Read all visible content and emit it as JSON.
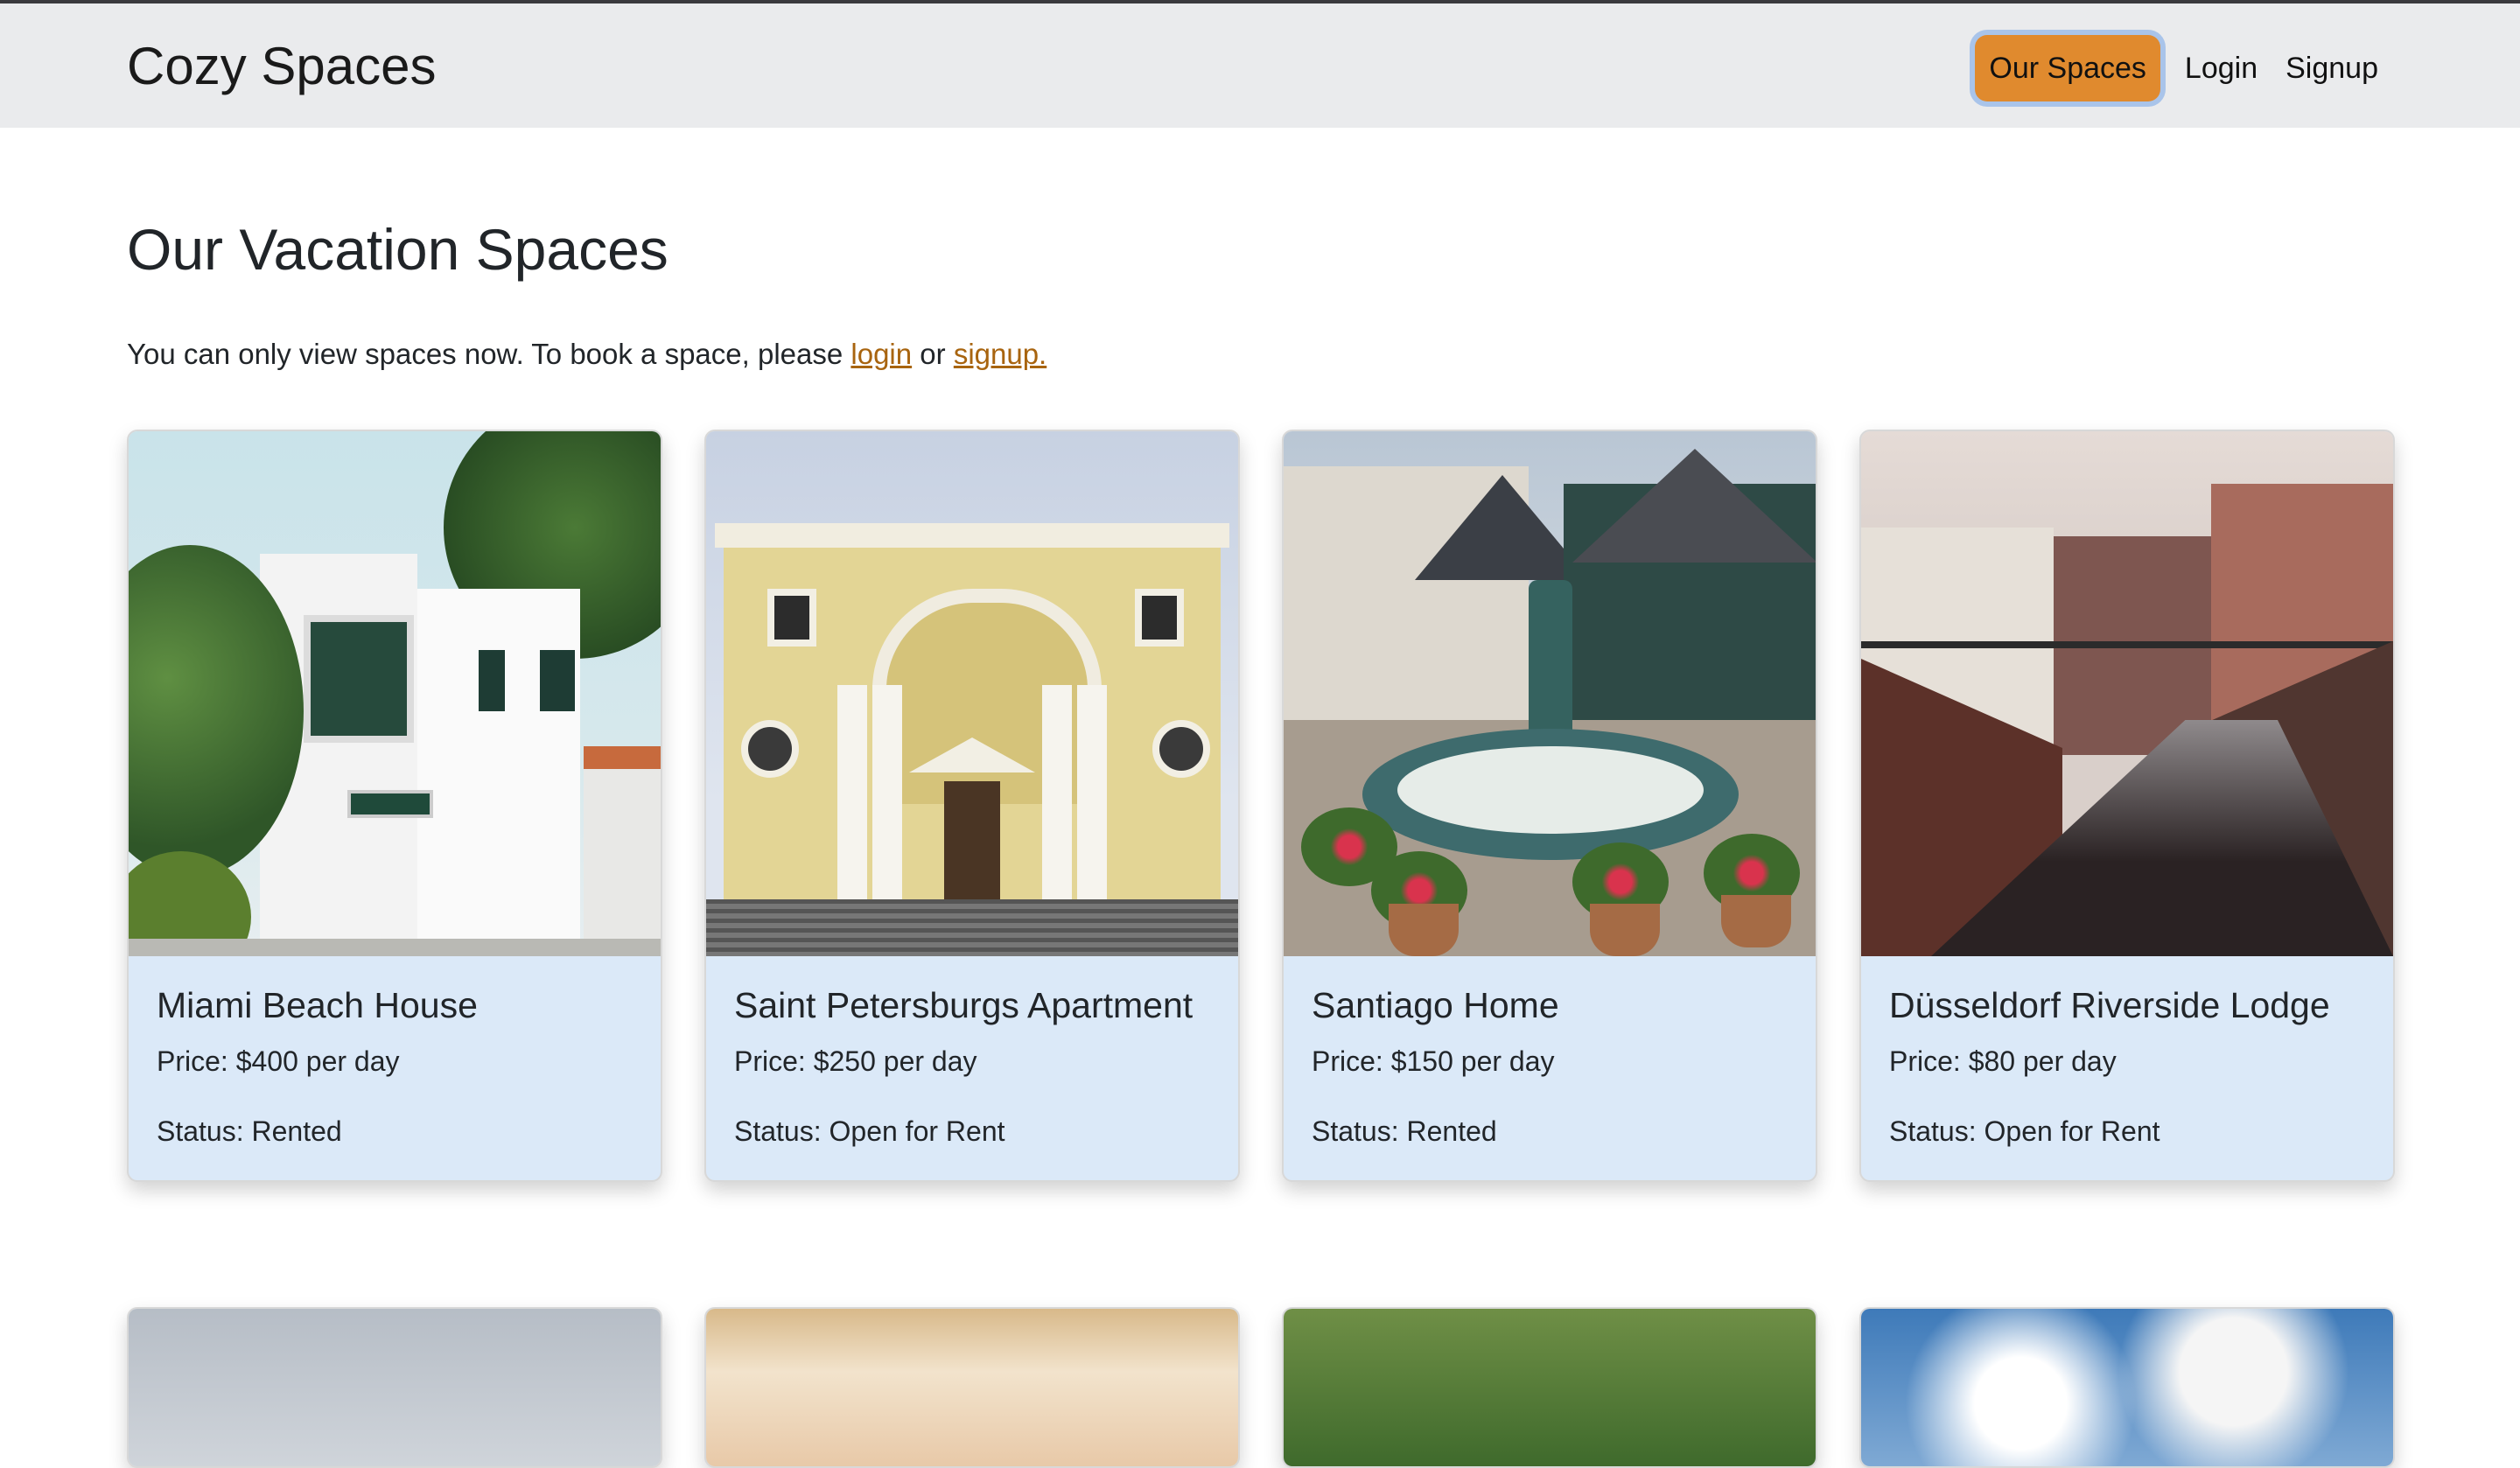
{
  "navbar": {
    "brand": "Cozy Spaces",
    "links": [
      {
        "label": "Our Spaces",
        "active": true
      },
      {
        "label": "Login",
        "active": false
      },
      {
        "label": "Signup",
        "active": false
      }
    ],
    "accent_color": "#e08a2e"
  },
  "main": {
    "title": "Our Vacation Spaces",
    "notice_prefix": "You can only view spaces now. To book a space, please ",
    "notice_login": "login",
    "notice_or": " or ",
    "notice_signup": "signup."
  },
  "cards": [
    {
      "name": "Miami Beach House",
      "price": "Price: $400 per day",
      "status": "Status: Rented",
      "image": "white-modern-house-photo"
    },
    {
      "name": "Saint Petersburgs Apartment",
      "price": "Price: $250 per day",
      "status": "Status: Open for Rent",
      "image": "yellow-cathedral-facade-photo"
    },
    {
      "name": "Santiago Home",
      "price": "Price: $150 per day",
      "status": "Status: Rented",
      "image": "plaza-fountain-photo"
    },
    {
      "name": "Düsseldorf Riverside Lodge",
      "price": "Price: $80 per day",
      "status": "Status: Open for Rent",
      "image": "canal-buildings-photo"
    }
  ],
  "cards_row2_images": [
    "overcast-sky-photo",
    "sunset-sky-photo",
    "trees-street-photo",
    "blue-sky-clouds-photo"
  ]
}
